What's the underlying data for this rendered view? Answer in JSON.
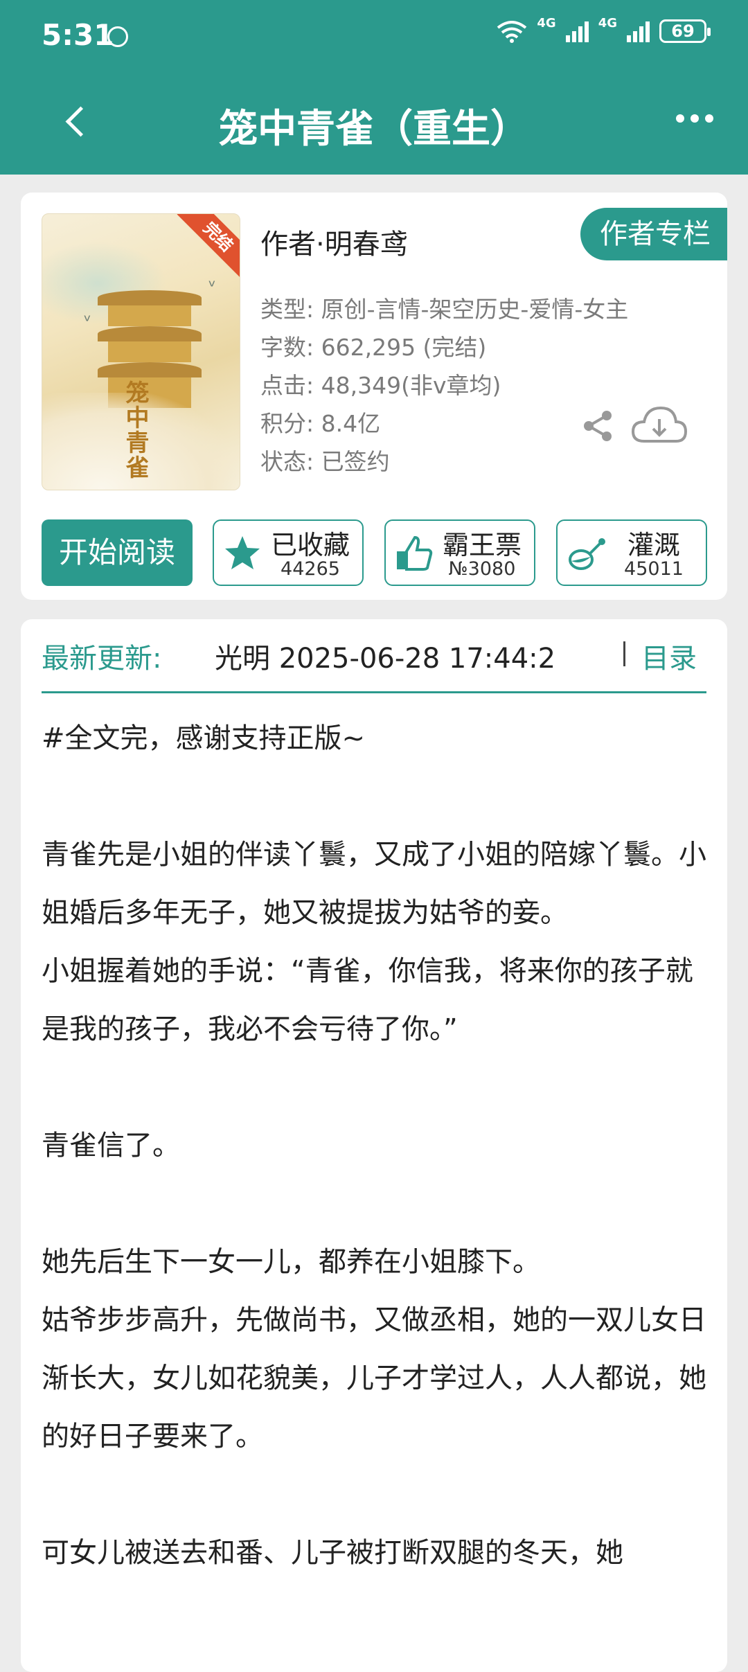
{
  "status_bar": {
    "time": "5:31",
    "network_1": "4G",
    "network_2": "4G",
    "battery": "69"
  },
  "app_bar": {
    "title": "笼中青雀（重生）"
  },
  "book": {
    "cover_title": "笼中青雀",
    "cover_badge": "完结",
    "author": "作者·明春鸢",
    "author_column_label": "作者专栏",
    "type": "类型: 原创-言情-架空历史-爱情-女主",
    "word_count": "字数: 662,295 (完结)",
    "clicks": "点击: 48,349(非v章均)",
    "score": "积分: 8.4亿",
    "status": "状态: 已签约"
  },
  "actions": {
    "read_label": "开始阅读",
    "favorite_label": "已收藏",
    "favorite_count": "44265",
    "ticket_label": "霸王票",
    "ticket_count": "№3080",
    "water_label": "灌溉",
    "water_count": "45011"
  },
  "latest": {
    "label": "最新更新:",
    "text": "光明  2025-06-28 17:44:2",
    "toc_label": "目录"
  },
  "intro": [
    "#全文完，感谢支持正版~",
    "",
    "青雀先是小姐的伴读丫鬟，又成了小姐的陪嫁丫鬟。小姐婚后多年无子，她又被提拔为姑爷的妾。",
    "小姐握着她的手说：“青雀，你信我，将来你的孩子就是我的孩子，我必不会亏待了你。”",
    "",
    "青雀信了。",
    "",
    "她先后生下一女一儿，都养在小姐膝下。",
    "姑爷步步高升，先做尚书，又做丞相，她的一双儿女日渐长大，女儿如花貌美，儿子才学过人，人人都说，她的好日子要来了。",
    "",
    "可女儿被送去和番、儿子被打断双腿的冬天，她"
  ],
  "colors": {
    "accent": "#2b9a8d",
    "ribbon": "#e0522e"
  },
  "icons": [
    "back-arrow-icon",
    "more-icon",
    "share-icon",
    "download-cloud-icon",
    "star-icon",
    "thumbs-up-icon",
    "watering-can-icon"
  ]
}
